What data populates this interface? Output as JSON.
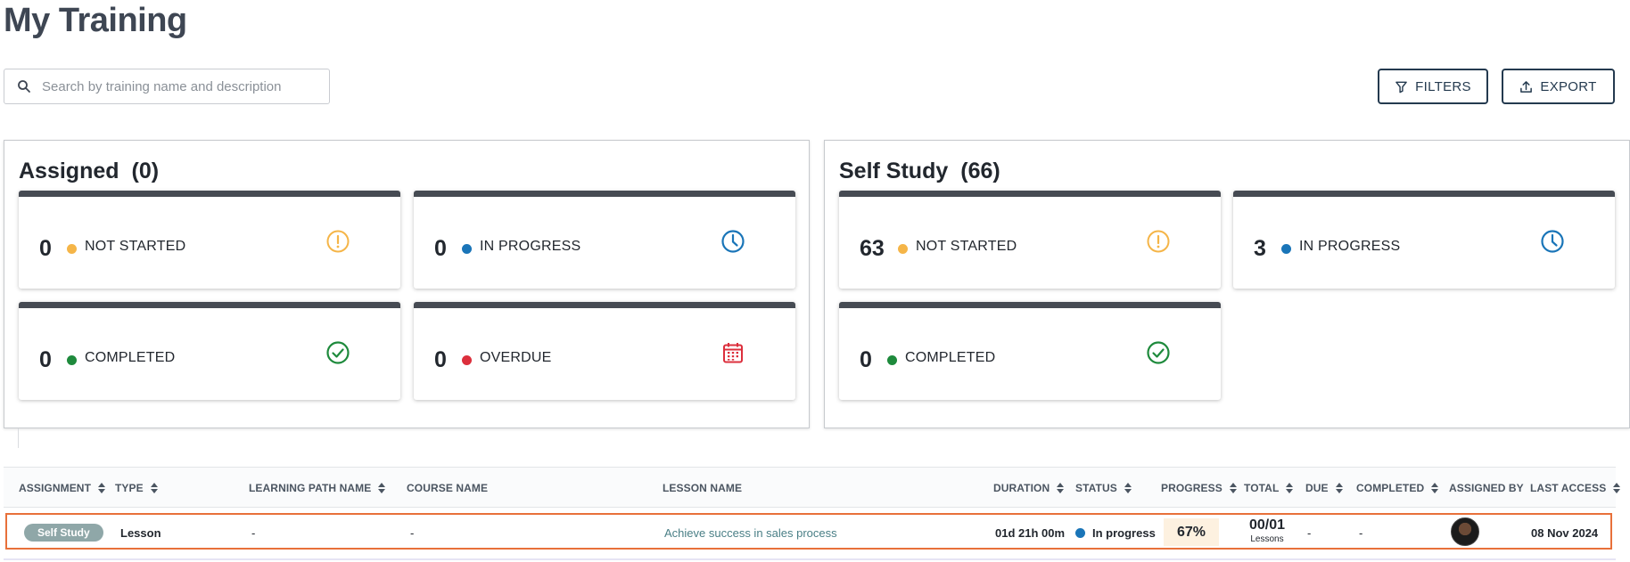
{
  "page_title": "My Training",
  "search": {
    "placeholder": "Search by training name and description",
    "value": ""
  },
  "toolbar": {
    "filters_label": "FILTERS",
    "export_label": "EXPORT"
  },
  "colors": {
    "not_started": "#f5b548",
    "in_progress": "#1a75b8",
    "completed": "#1e8a3c",
    "overdue": "#dc2f3c",
    "primary": "#243a4f",
    "highlight_row_border": "#e8703a"
  },
  "assigned": {
    "title": "Assigned",
    "count": "(0)",
    "cards": {
      "not_started": {
        "value": "0",
        "label": "NOT STARTED",
        "icon": "alert-circle-icon"
      },
      "in_progress": {
        "value": "0",
        "label": "IN PROGRESS",
        "icon": "clock-icon"
      },
      "completed": {
        "value": "0",
        "label": "COMPLETED",
        "icon": "check-circle-icon"
      },
      "overdue": {
        "value": "0",
        "label": "OVERDUE",
        "icon": "calendar-icon"
      }
    }
  },
  "self_study": {
    "title": "Self Study",
    "count": "(66)",
    "cards": {
      "not_started": {
        "value": "63",
        "label": "NOT STARTED",
        "icon": "alert-circle-icon"
      },
      "in_progress": {
        "value": "3",
        "label": "IN PROGRESS",
        "icon": "clock-icon"
      },
      "completed": {
        "value": "0",
        "label": "COMPLETED",
        "icon": "check-circle-icon"
      }
    }
  },
  "table": {
    "columns": {
      "assignment": "ASSIGNMENT",
      "type": "TYPE",
      "learning_path": "LEARNING PATH NAME",
      "course": "COURSE NAME",
      "lesson": "LESSON NAME",
      "duration": "DURATION",
      "status": "STATUS",
      "progress": "PROGRESS",
      "total": "TOTAL",
      "due": "DUE",
      "completed": "COMPLETED",
      "assigned_by": "ASSIGNED BY",
      "last_access": "LAST ACCESS"
    },
    "rows": [
      {
        "assignment": "Self Study",
        "type": "Lesson",
        "learning_path": "-",
        "course": "-",
        "lesson": "Achieve success in sales process",
        "duration": "01d 21h 00m",
        "status": "In progress",
        "progress": "67%",
        "total": "00/01",
        "total_unit": "Lessons",
        "due": "-",
        "completed": "-",
        "last_access": "08 Nov 2024"
      }
    ]
  }
}
